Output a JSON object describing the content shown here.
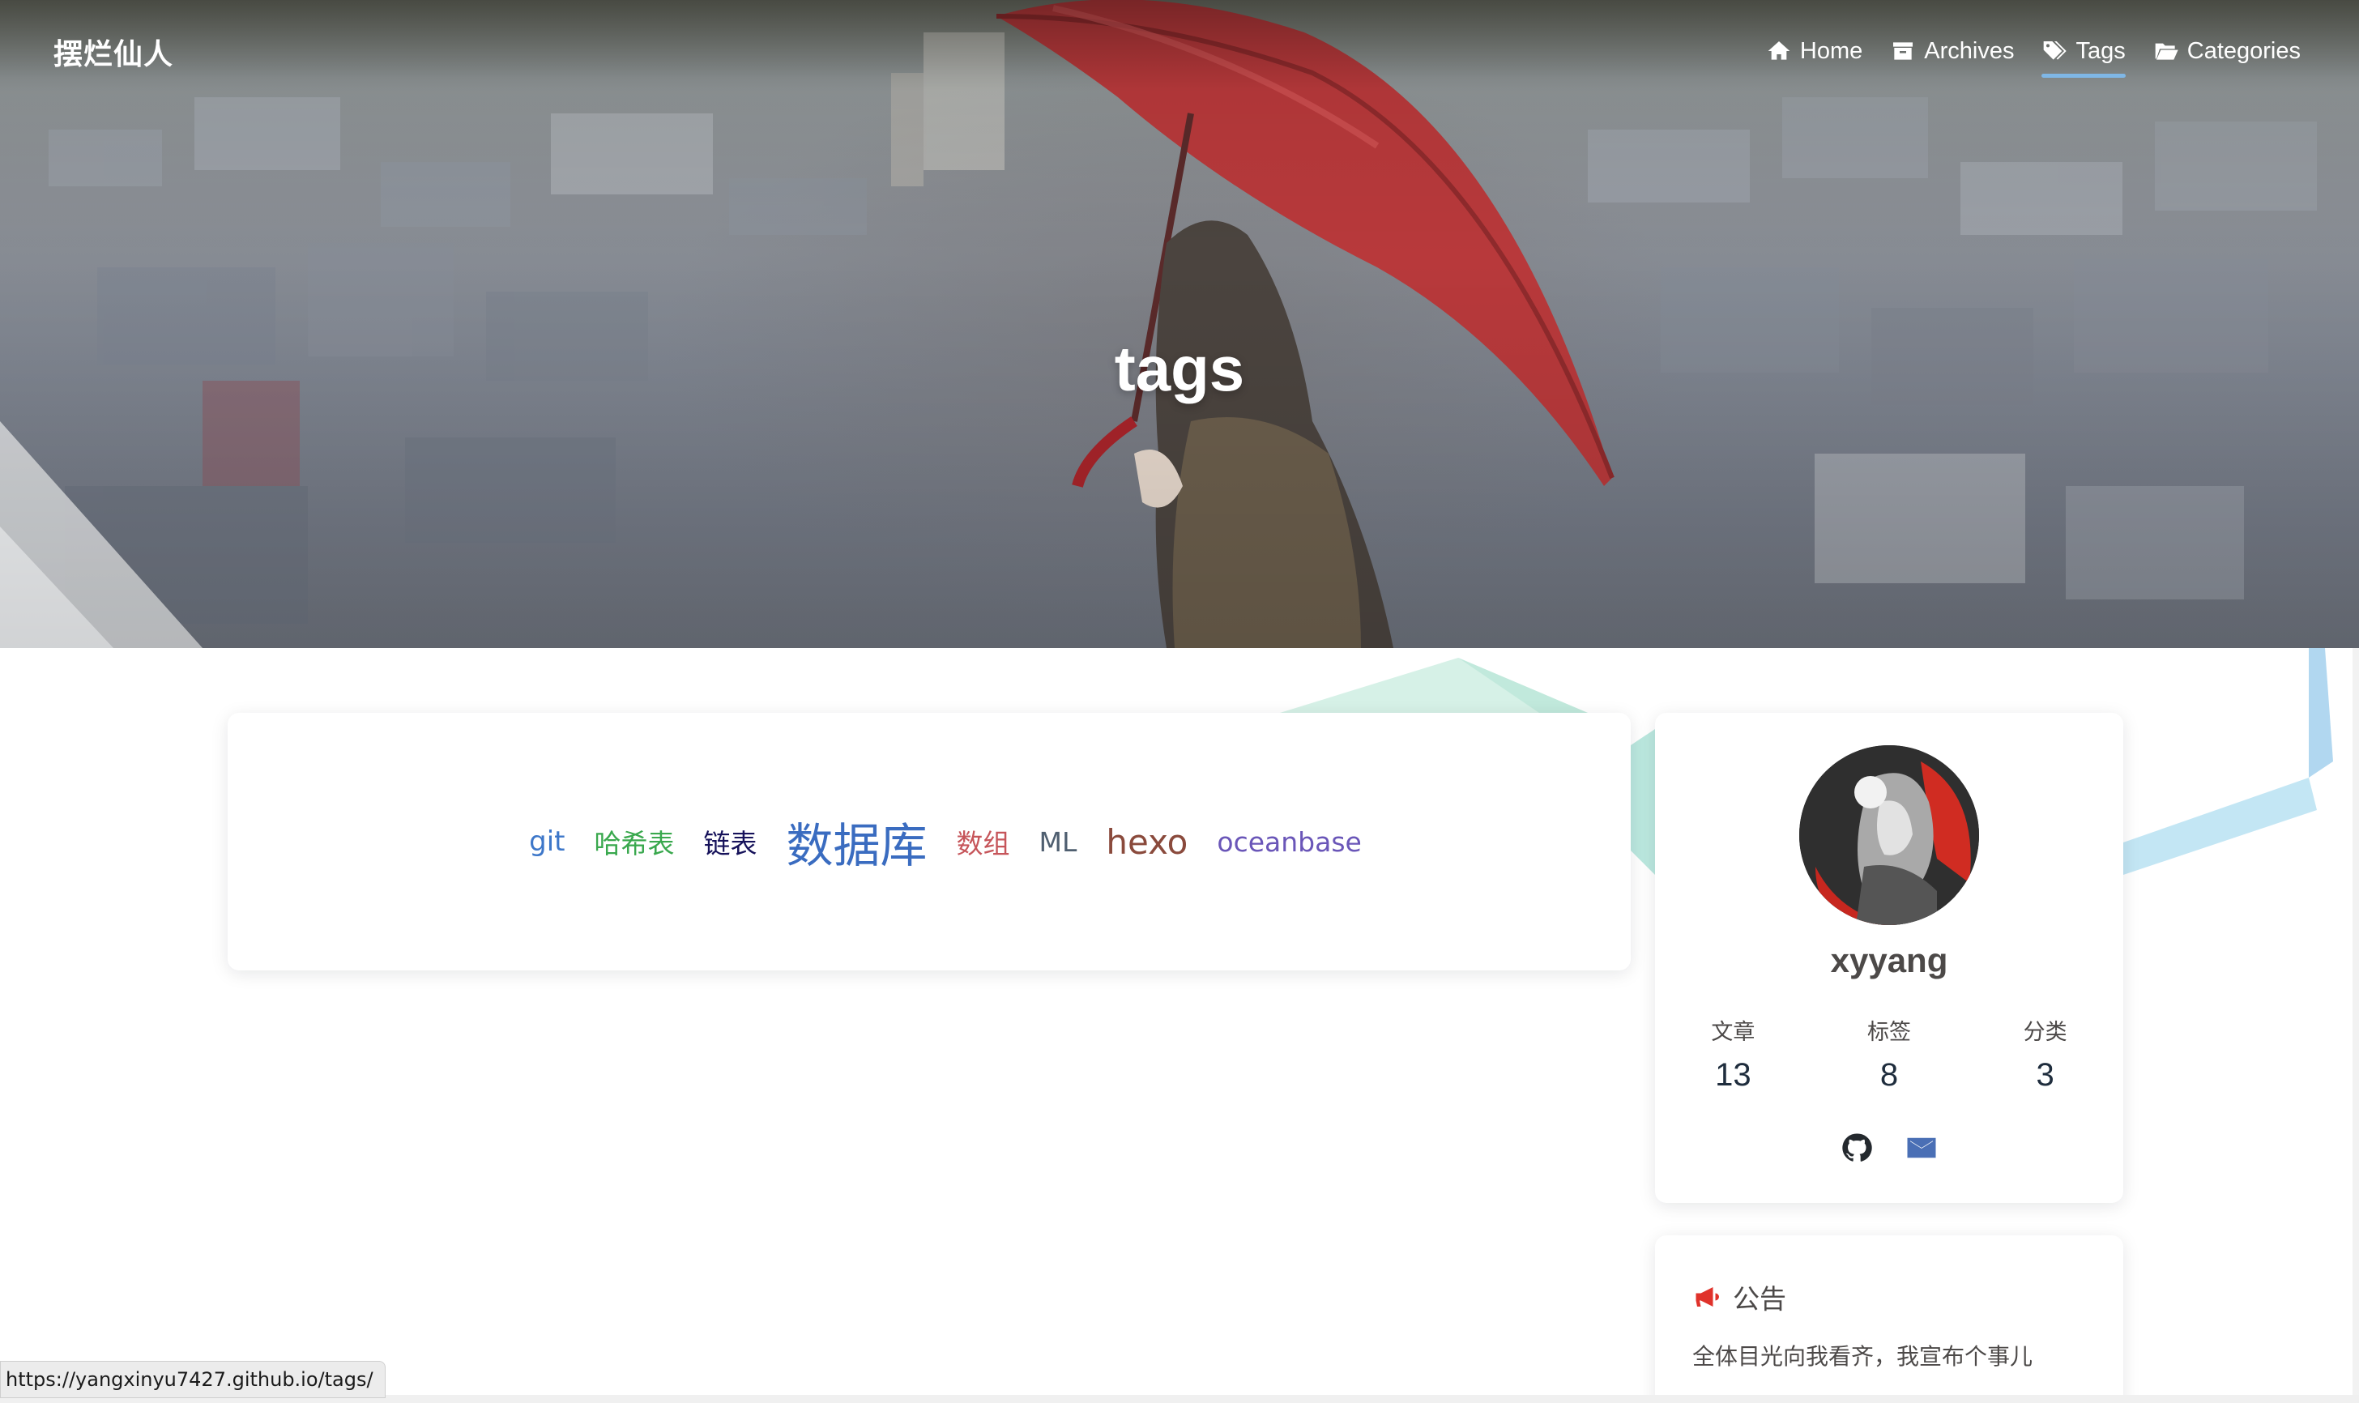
{
  "site": {
    "title": "摆烂仙人"
  },
  "nav": {
    "items": [
      {
        "label": "Home",
        "icon": "home-icon",
        "active": false
      },
      {
        "label": "Archives",
        "icon": "archive-icon",
        "active": false
      },
      {
        "label": "Tags",
        "icon": "tags-icon",
        "active": true
      },
      {
        "label": "Categories",
        "icon": "folder-open-icon",
        "active": false
      }
    ]
  },
  "page": {
    "title": "tags"
  },
  "tag_cloud": {
    "tags": [
      {
        "name": "git",
        "color": "#3d77c9"
      },
      {
        "name": "哈希表",
        "color": "#39a84d"
      },
      {
        "name": "链表",
        "color": "#16125a"
      },
      {
        "name": "数据库",
        "color": "#3a6cc0"
      },
      {
        "name": "数组",
        "color": "#c6555a"
      },
      {
        "name": "ML",
        "color": "#4f5f70"
      },
      {
        "name": "hexo",
        "color": "#8a4a3c"
      },
      {
        "name": "oceanbase",
        "color": "#6a56b8"
      }
    ]
  },
  "profile": {
    "name": "xyyang",
    "stats": [
      {
        "label": "文章",
        "value": "13"
      },
      {
        "label": "标签",
        "value": "8"
      },
      {
        "label": "分类",
        "value": "3"
      }
    ],
    "social": [
      {
        "icon": "github-icon",
        "color": "#24292e"
      },
      {
        "icon": "email-icon",
        "color": "#4a6fb5"
      }
    ]
  },
  "notice": {
    "title": "公告",
    "text": "全体目光向我看齐，我宣布个事儿",
    "icon_color": "#e0322b"
  },
  "statusbar": {
    "url": "https://yangxinyu7427.github.io/tags/"
  }
}
